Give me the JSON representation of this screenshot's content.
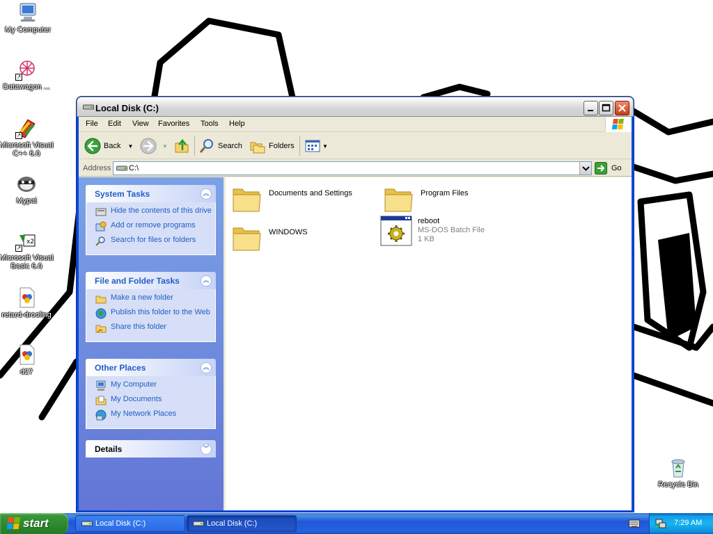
{
  "desktop": {
    "icons": [
      {
        "label": "My Computer"
      },
      {
        "label": "Datawagon ..."
      },
      {
        "label": "Microsoft Visual C++ 6.0"
      },
      {
        "label": "Mypal"
      },
      {
        "label": "Microsoft Visual Basic 6.0"
      },
      {
        "label": "retard-drooling"
      },
      {
        "label": "d27"
      },
      {
        "label": "Recycle Bin"
      }
    ]
  },
  "window": {
    "title": "Local Disk (C:)",
    "menu": [
      "File",
      "Edit",
      "View",
      "Favorites",
      "Tools",
      "Help"
    ],
    "toolbar": {
      "back": "Back",
      "search": "Search",
      "folders": "Folders"
    },
    "address": {
      "label": "Address",
      "value": "C:\\",
      "go": "Go"
    },
    "taskpane": {
      "system_tasks": {
        "title": "System Tasks",
        "items": [
          {
            "label": "Hide the contents of this drive",
            "icon": "hide-contents-icon"
          },
          {
            "label": "Add or remove programs",
            "icon": "add-remove-icon"
          },
          {
            "label": "Search for files or folders",
            "icon": "search-icon"
          }
        ]
      },
      "file_folder_tasks": {
        "title": "File and Folder Tasks",
        "items": [
          {
            "label": "Make a new folder",
            "icon": "new-folder-icon"
          },
          {
            "label": "Publish this folder to the Web",
            "icon": "publish-web-icon"
          },
          {
            "label": "Share this folder",
            "icon": "share-folder-icon"
          }
        ]
      },
      "other_places": {
        "title": "Other Places",
        "items": [
          {
            "label": "My Computer",
            "icon": "my-computer-icon"
          },
          {
            "label": "My Documents",
            "icon": "my-documents-icon"
          },
          {
            "label": "My Network Places",
            "icon": "network-places-icon"
          }
        ]
      },
      "details": {
        "title": "Details"
      }
    },
    "files": [
      {
        "name": "Documents and Settings",
        "type": "folder"
      },
      {
        "name": "Program Files",
        "type": "folder"
      },
      {
        "name": "WINDOWS",
        "type": "folder"
      },
      {
        "name": "reboot",
        "type": "batch",
        "sub1": "MS-DOS Batch File",
        "sub2": "1 KB"
      }
    ]
  },
  "taskbar": {
    "start": "start",
    "tasks": [
      {
        "label": "Local Disk (C:)"
      },
      {
        "label": "Local Disk (C:)"
      }
    ],
    "clock": "7:29 AM"
  },
  "colors": {
    "link": "#215dc6",
    "taskbar": "#2157d7",
    "start": "#2f8a2f"
  }
}
